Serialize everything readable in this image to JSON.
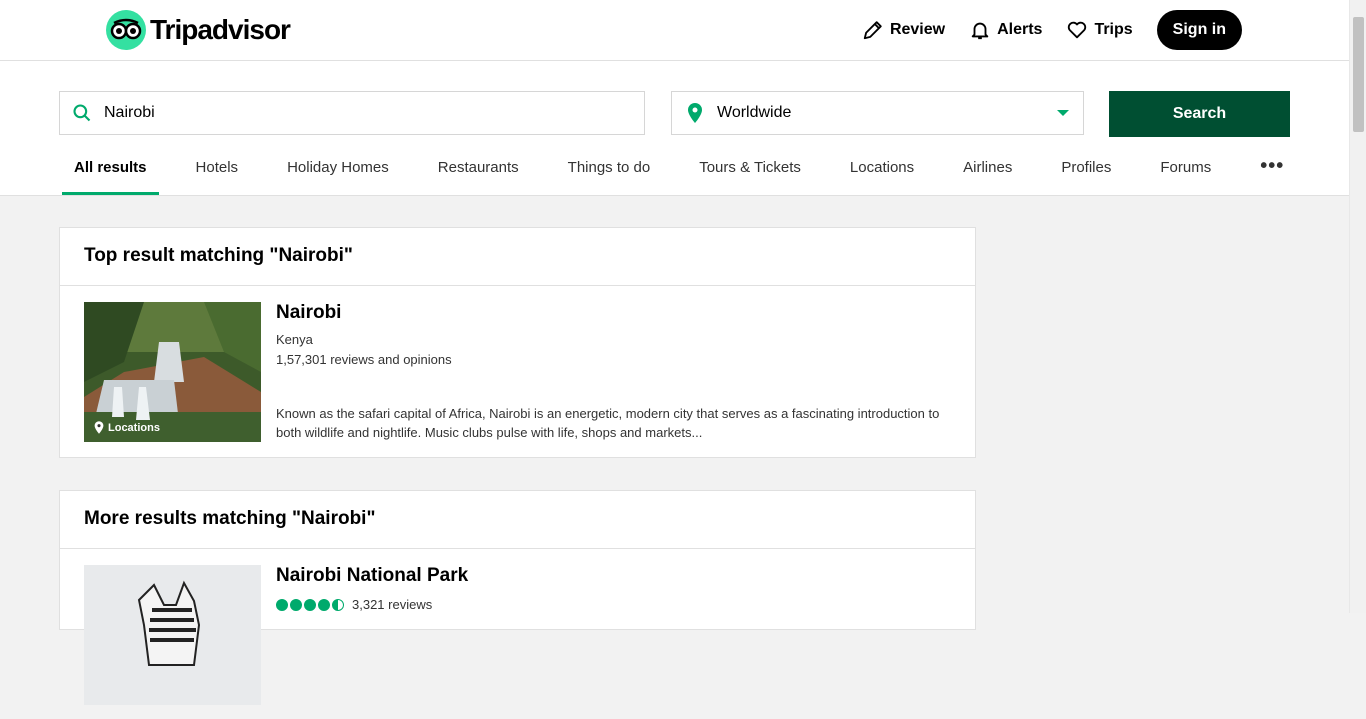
{
  "header": {
    "logo_text": "Tripadvisor",
    "nav": [
      {
        "label": "Review",
        "icon": "pencil-icon"
      },
      {
        "label": "Alerts",
        "icon": "bell-icon"
      },
      {
        "label": "Trips",
        "icon": "heart-icon"
      }
    ],
    "signin_label": "Sign in"
  },
  "search": {
    "query": "Nairobi",
    "location": "Worldwide",
    "button_label": "Search"
  },
  "tabs": [
    {
      "label": "All results",
      "active": true
    },
    {
      "label": "Hotels"
    },
    {
      "label": "Holiday Homes"
    },
    {
      "label": "Restaurants"
    },
    {
      "label": "Things to do"
    },
    {
      "label": "Tours & Tickets"
    },
    {
      "label": "Locations"
    },
    {
      "label": "Airlines"
    },
    {
      "label": "Profiles"
    },
    {
      "label": "Forums"
    },
    {
      "label": "•••"
    }
  ],
  "top_result": {
    "heading": "Top result matching \"Nairobi\"",
    "title": "Nairobi",
    "subtitle": "Kenya",
    "reviews": "1,57,301 reviews and opinions",
    "thumb_label": "Locations",
    "description": "Known as the safari capital of Africa, Nairobi is an energetic, modern city that serves as a fascinating introduction to both wildlife and nightlife. Music clubs pulse with life, shops and markets..."
  },
  "more_results": {
    "heading": "More results matching \"Nairobi\"",
    "items": [
      {
        "title": "Nairobi National Park",
        "rating": 4.5,
        "reviews": "3,321 reviews"
      }
    ]
  },
  "colors": {
    "brand_green": "#34e0a1",
    "search_button": "#004f32",
    "accent": "#00aa6c"
  }
}
